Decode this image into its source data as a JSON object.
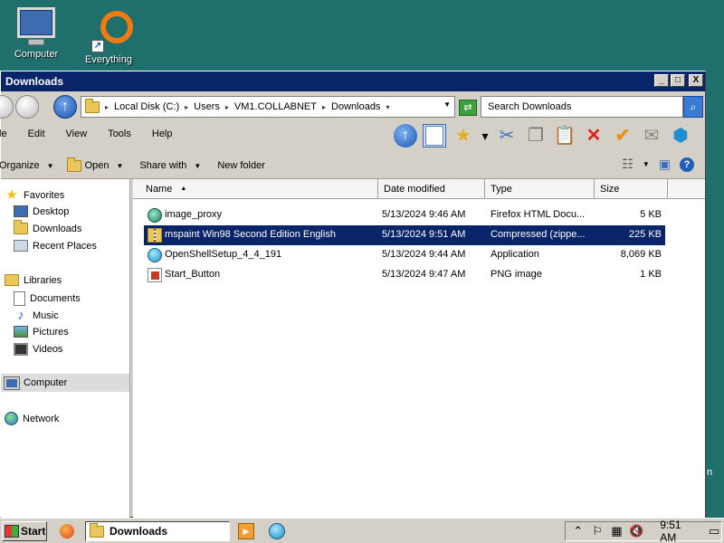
{
  "desktop": {
    "icons": [
      {
        "label": "Computer",
        "icon": "monitor-icon"
      },
      {
        "label": "Everything",
        "icon": "everything-ring-icon"
      }
    ],
    "partial_text": "n"
  },
  "window": {
    "title": "Downloads",
    "title_buttons": {
      "minimize": "_",
      "maximize": "□",
      "close": "X"
    },
    "address": {
      "crumbs": [
        "Local Disk (C:)",
        "Users",
        "VM1.COLLABNET",
        "Downloads"
      ]
    },
    "search": {
      "value": "Search Downloads"
    },
    "menu": [
      "File",
      "Edit",
      "View",
      "Tools",
      "Help"
    ],
    "menu_display": [
      "le",
      "Edit",
      "View",
      "Tools",
      "Help"
    ],
    "commands": {
      "organize": "Organize",
      "open": "Open",
      "share_with": "Share with",
      "new_folder": "New folder"
    },
    "nav": {
      "favorites": {
        "title": "Favorites",
        "items": [
          "Desktop",
          "Downloads",
          "Recent Places"
        ]
      },
      "libraries": {
        "title": "Libraries",
        "items": [
          "Documents",
          "Music",
          "Pictures",
          "Videos"
        ]
      },
      "computer": "Computer",
      "network": "Network"
    },
    "columns": [
      "Name",
      "Date modified",
      "Type",
      "Size"
    ],
    "files": [
      {
        "name": "image_proxy",
        "date": "5/13/2024 9:46 AM",
        "type": "Firefox HTML Docu...",
        "size": "5 KB",
        "icon": "firefox-html-icon",
        "selected": false
      },
      {
        "name": "mspaint Win98 Second Edition English",
        "date": "5/13/2024 9:51 AM",
        "type": "Compressed (zippe...",
        "size": "225 KB",
        "icon": "zip-folder-icon",
        "selected": true
      },
      {
        "name": "OpenShellSetup_4_4_191",
        "date": "5/13/2024 9:44 AM",
        "type": "Application",
        "size": "8,069 KB",
        "icon": "openshell-app-icon",
        "selected": false
      },
      {
        "name": "Start_Button",
        "date": "5/13/2024 9:47 AM",
        "type": "PNG image",
        "size": "1 KB",
        "icon": "png-image-icon",
        "selected": false
      }
    ]
  },
  "taskbar": {
    "start_label": "Start",
    "active_task": "Downloads",
    "clock": "9:51 AM"
  },
  "colors": {
    "desktop": "#1f6f6c",
    "titlebar": "#0a246a",
    "selection": "#0a246a",
    "chrome": "#d4d0c8"
  }
}
